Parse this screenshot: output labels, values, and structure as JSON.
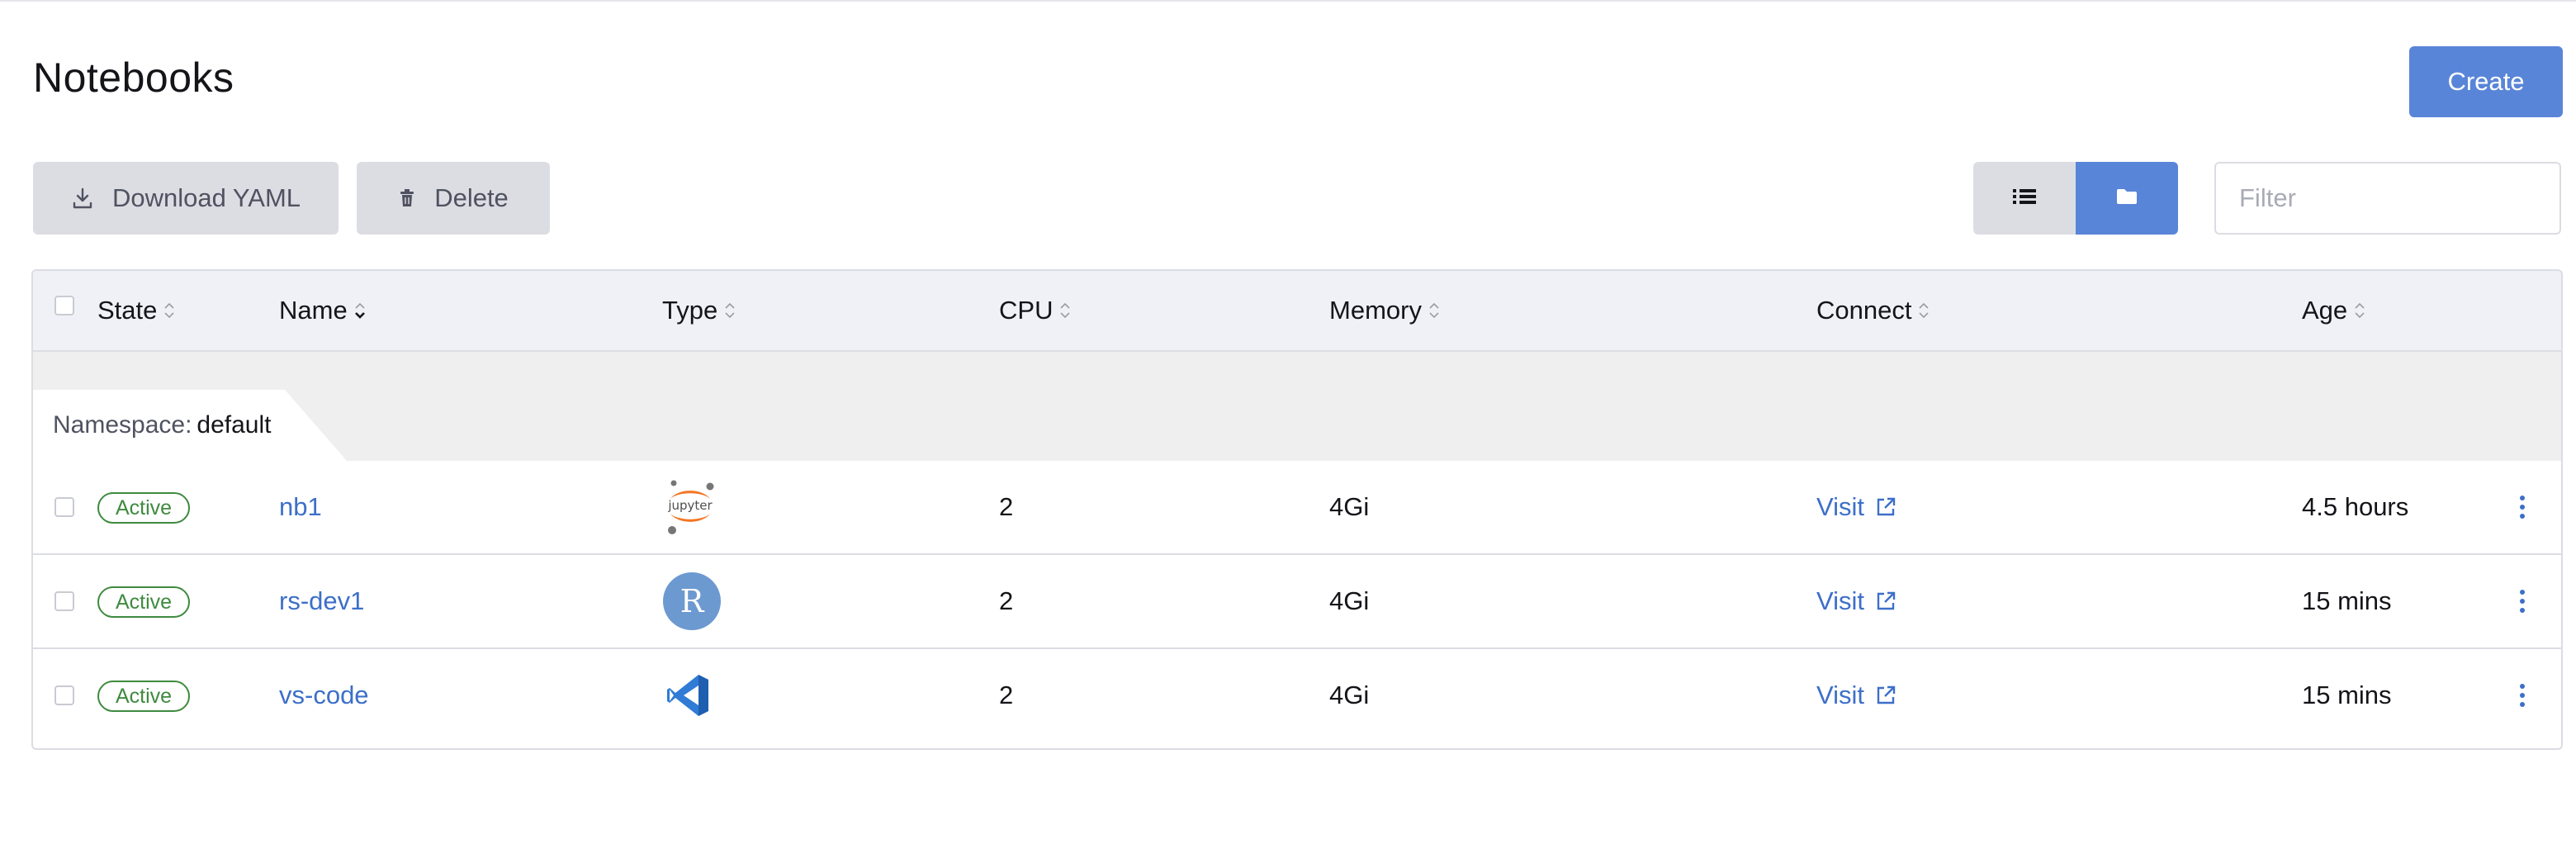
{
  "page": {
    "title": "Notebooks"
  },
  "actions": {
    "create_label": "Create",
    "download_label": "Download YAML",
    "delete_label": "Delete",
    "view_modes": [
      "list",
      "grouped"
    ],
    "active_view": "grouped"
  },
  "filter": {
    "placeholder": "Filter",
    "value": ""
  },
  "table": {
    "columns": [
      {
        "label": "State",
        "sort": "none"
      },
      {
        "label": "Name",
        "sort": "descending"
      },
      {
        "label": "Type",
        "sort": "none"
      },
      {
        "label": "CPU",
        "sort": "none"
      },
      {
        "label": "Memory",
        "sort": "none"
      },
      {
        "label": "Connect",
        "sort": "none"
      },
      {
        "label": "Age",
        "sort": "none"
      }
    ],
    "group": {
      "key_label": "Namespace:",
      "value": "default"
    },
    "rows": [
      {
        "state": "Active",
        "name": "nb1",
        "type_icon": "jupyter-logo-icon",
        "cpu": "2",
        "memory": "4Gi",
        "connect": "Visit",
        "age": "4.5 hours"
      },
      {
        "state": "Active",
        "name": "rs-dev1",
        "type_icon": "r-logo-icon",
        "cpu": "2",
        "memory": "4Gi",
        "connect": "Visit",
        "age": "15 mins"
      },
      {
        "state": "Active",
        "name": "vs-code",
        "type_icon": "vscode-logo-icon",
        "cpu": "2",
        "memory": "4Gi",
        "connect": "Visit",
        "age": "15 mins"
      }
    ]
  },
  "colors": {
    "primary": "#5985d8",
    "link": "#3d6fc9",
    "active_badge": "#3f8a3f",
    "header_bg": "#eff1f6",
    "group_bg": "#efefef"
  }
}
